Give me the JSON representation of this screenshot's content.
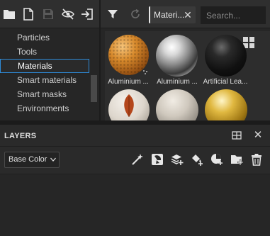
{
  "shelf": {
    "toolbar": {
      "icons": [
        "folder-icon",
        "new-document-icon",
        "save-icon",
        "hide-icon",
        "import-icon"
      ]
    },
    "categories": [
      {
        "label": "Particles",
        "selected": false
      },
      {
        "label": "Tools",
        "selected": false
      },
      {
        "label": "Materials",
        "selected": true
      },
      {
        "label": "Smart materials",
        "selected": false
      },
      {
        "label": "Smart masks",
        "selected": false
      },
      {
        "label": "Environments",
        "selected": false
      }
    ],
    "filter": {
      "tag_label": "Materi...",
      "close_glyph": "✕"
    },
    "search": {
      "placeholder": "Search...",
      "value": ""
    },
    "assets": [
      {
        "label": "Aluminium ..."
      },
      {
        "label": "Aluminium ..."
      },
      {
        "label": "Artificial Lea..."
      },
      {
        "label": ""
      },
      {
        "label": ""
      },
      {
        "label": ""
      }
    ]
  },
  "layers": {
    "title": "LAYERS",
    "close_glyph": "✕",
    "channel": {
      "selected": "Base Color"
    },
    "tools": [
      "add-effect-icon",
      "add-mask-icon",
      "add-layer-icon",
      "add-fill-layer-icon",
      "add-smart-material-icon",
      "add-folder-icon",
      "delete-icon"
    ]
  },
  "colors": {
    "accent": "#2e8bd8",
    "panel_bg": "#2a2a2a",
    "dark_bg": "#262626"
  }
}
